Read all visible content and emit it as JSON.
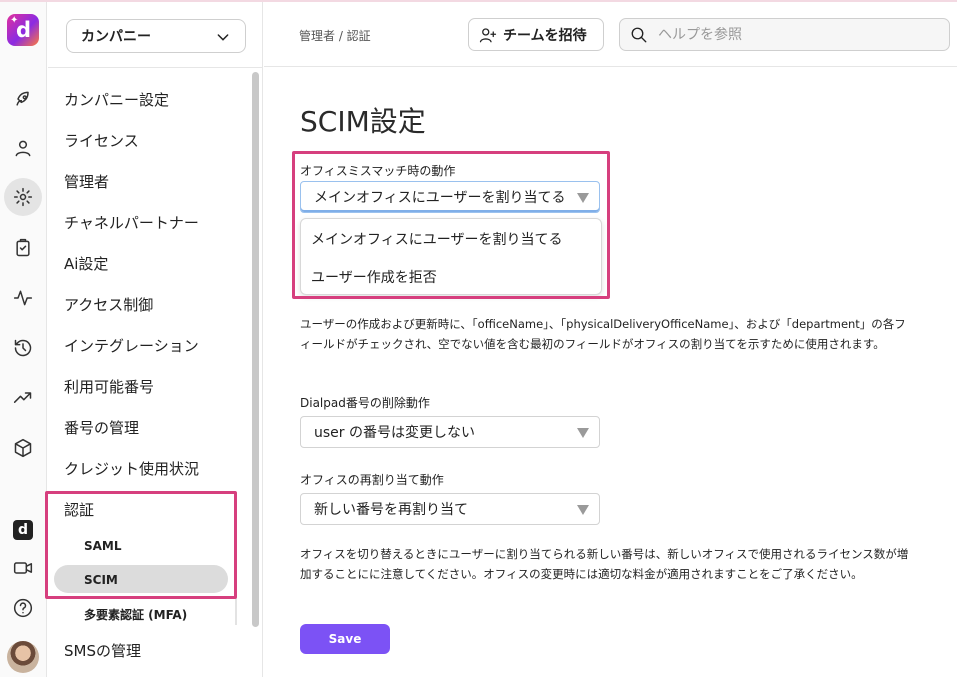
{
  "colors": {
    "accent": "#7c52f5",
    "highlight": "#d63f7e",
    "logo_gradient": [
      "#e2319c",
      "#8a2be2",
      "#ff7a3d"
    ]
  },
  "rail": {
    "logo_letter": "d",
    "icons": [
      "rocket-icon",
      "person-icon",
      "gear-icon",
      "clipboard-icon",
      "activity-icon",
      "history-icon",
      "trending-icon",
      "box-icon",
      "dialpad-ai-icon",
      "video-icon",
      "help-icon",
      "avatar"
    ]
  },
  "sidenav": {
    "company_select": "カンパニー",
    "items": [
      {
        "label": "カンパニー設定"
      },
      {
        "label": "ライセンス"
      },
      {
        "label": "管理者"
      },
      {
        "label": "チャネルパートナー"
      },
      {
        "label": "Ai設定"
      },
      {
        "label": "アクセス制御"
      },
      {
        "label": "インテグレーション"
      },
      {
        "label": "利用可能番号"
      },
      {
        "label": "番号の管理"
      },
      {
        "label": "クレジット使用状況"
      },
      {
        "label": "認証"
      }
    ],
    "subitems": [
      {
        "label": "SAML"
      },
      {
        "label": "SCIM",
        "active": true
      },
      {
        "label": "多要素認証 (MFA)"
      }
    ],
    "last_item": "SMSの管理"
  },
  "header": {
    "breadcrumb": "管理者 / 認証",
    "invite_label": "チームを招待",
    "search_placeholder": "ヘルプを参照"
  },
  "main": {
    "title": "SCIM設定",
    "office_mismatch": {
      "label": "オフィスミスマッチ時の動作",
      "value": "メインオフィスにユーザーを割り当てる",
      "options": [
        "メインオフィスにユーザーを割り当てる",
        "ユーザー作成を拒否"
      ]
    },
    "description_1": "ユーザーの作成および更新時に、「officeName」、「physicalDeliveryOfficeName」、および「department」の各フィールドがチェックされ、空でない値を含む最初のフィールドがオフィスの割り当てを示すために使用されます。",
    "delete_action": {
      "label": "Dialpad番号の削除動作",
      "value": "user の番号は変更しない"
    },
    "reassign_action": {
      "label": "オフィスの再割り当て動作",
      "value": "新しい番号を再割り当て"
    },
    "description_2": "オフィスを切り替えるときにユーザーに割り当てられる新しい番号は、新しいオフィスで使用されるライセンス数が増加することにに注意してください。オフィスの変更時には適切な料金が適用されますことをご了承ください。",
    "save_label": "Save"
  }
}
